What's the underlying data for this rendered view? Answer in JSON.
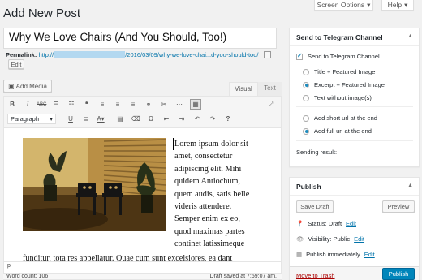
{
  "header": {
    "page_title": "Add New Post",
    "screen_options": "Screen Options",
    "help": "Help"
  },
  "post": {
    "title": "Why We Love Chairs (And You Should, Too!)",
    "permalink_label": "Permalink:",
    "permalink_prefix": "http://",
    "permalink_path": "/2016/03/09/why-we-love-chai...d-you-should-too/",
    "edit_label": "Edit"
  },
  "editor": {
    "add_media": "Add Media",
    "tab_visual": "Visual",
    "tab_text": "Text",
    "format_select": "Paragraph",
    "toolbar_row1": [
      "B",
      "I",
      "ABC",
      "•≡",
      "1≡",
      "❝",
      "≡",
      "≡",
      "≡",
      "🔗",
      "✂",
      "≡",
      "▦"
    ],
    "body_lines": [
      "Lorem ipsum dolor sit",
      "amet, consectetur",
      "adipiscing elit. Mihi",
      "quidem Antiochum,",
      "quem audis, satis belle",
      "videris attendere.",
      "Semper enim ex eo,",
      "quod maximas partes",
      "continet latissimeque"
    ],
    "overflow_line": "funditur, tota res appellatur. Quae cum sunt excelsiores, ea dant",
    "path": "p",
    "word_count": "Word count: 106",
    "draft_saved": "Draft saved at 7:59:07 am."
  },
  "telegram": {
    "title": "Send to Telegram Channel",
    "send_checkbox": "Send to Telegram Channel",
    "options": [
      "Title + Featured Image",
      "Excerpt + Featured Image",
      "Text without image(s)"
    ],
    "selected": 1,
    "url_options": [
      "Add short url at the end",
      "Add full url at the end"
    ],
    "url_selected": 1,
    "result_label": "Sending result:"
  },
  "publish": {
    "title": "Publish",
    "save_draft": "Save Draft",
    "preview": "Preview",
    "status_label": "Status: Draft",
    "visibility_label": "Visibility: Public",
    "schedule_label": "Publish immediately",
    "edit": "Edit",
    "trash": "Move to Trash",
    "publish_button": "Publish"
  },
  "colors": {
    "accent": "#0073aa",
    "publish_bg": "#0085ba",
    "selection": "#b3d8f0"
  }
}
